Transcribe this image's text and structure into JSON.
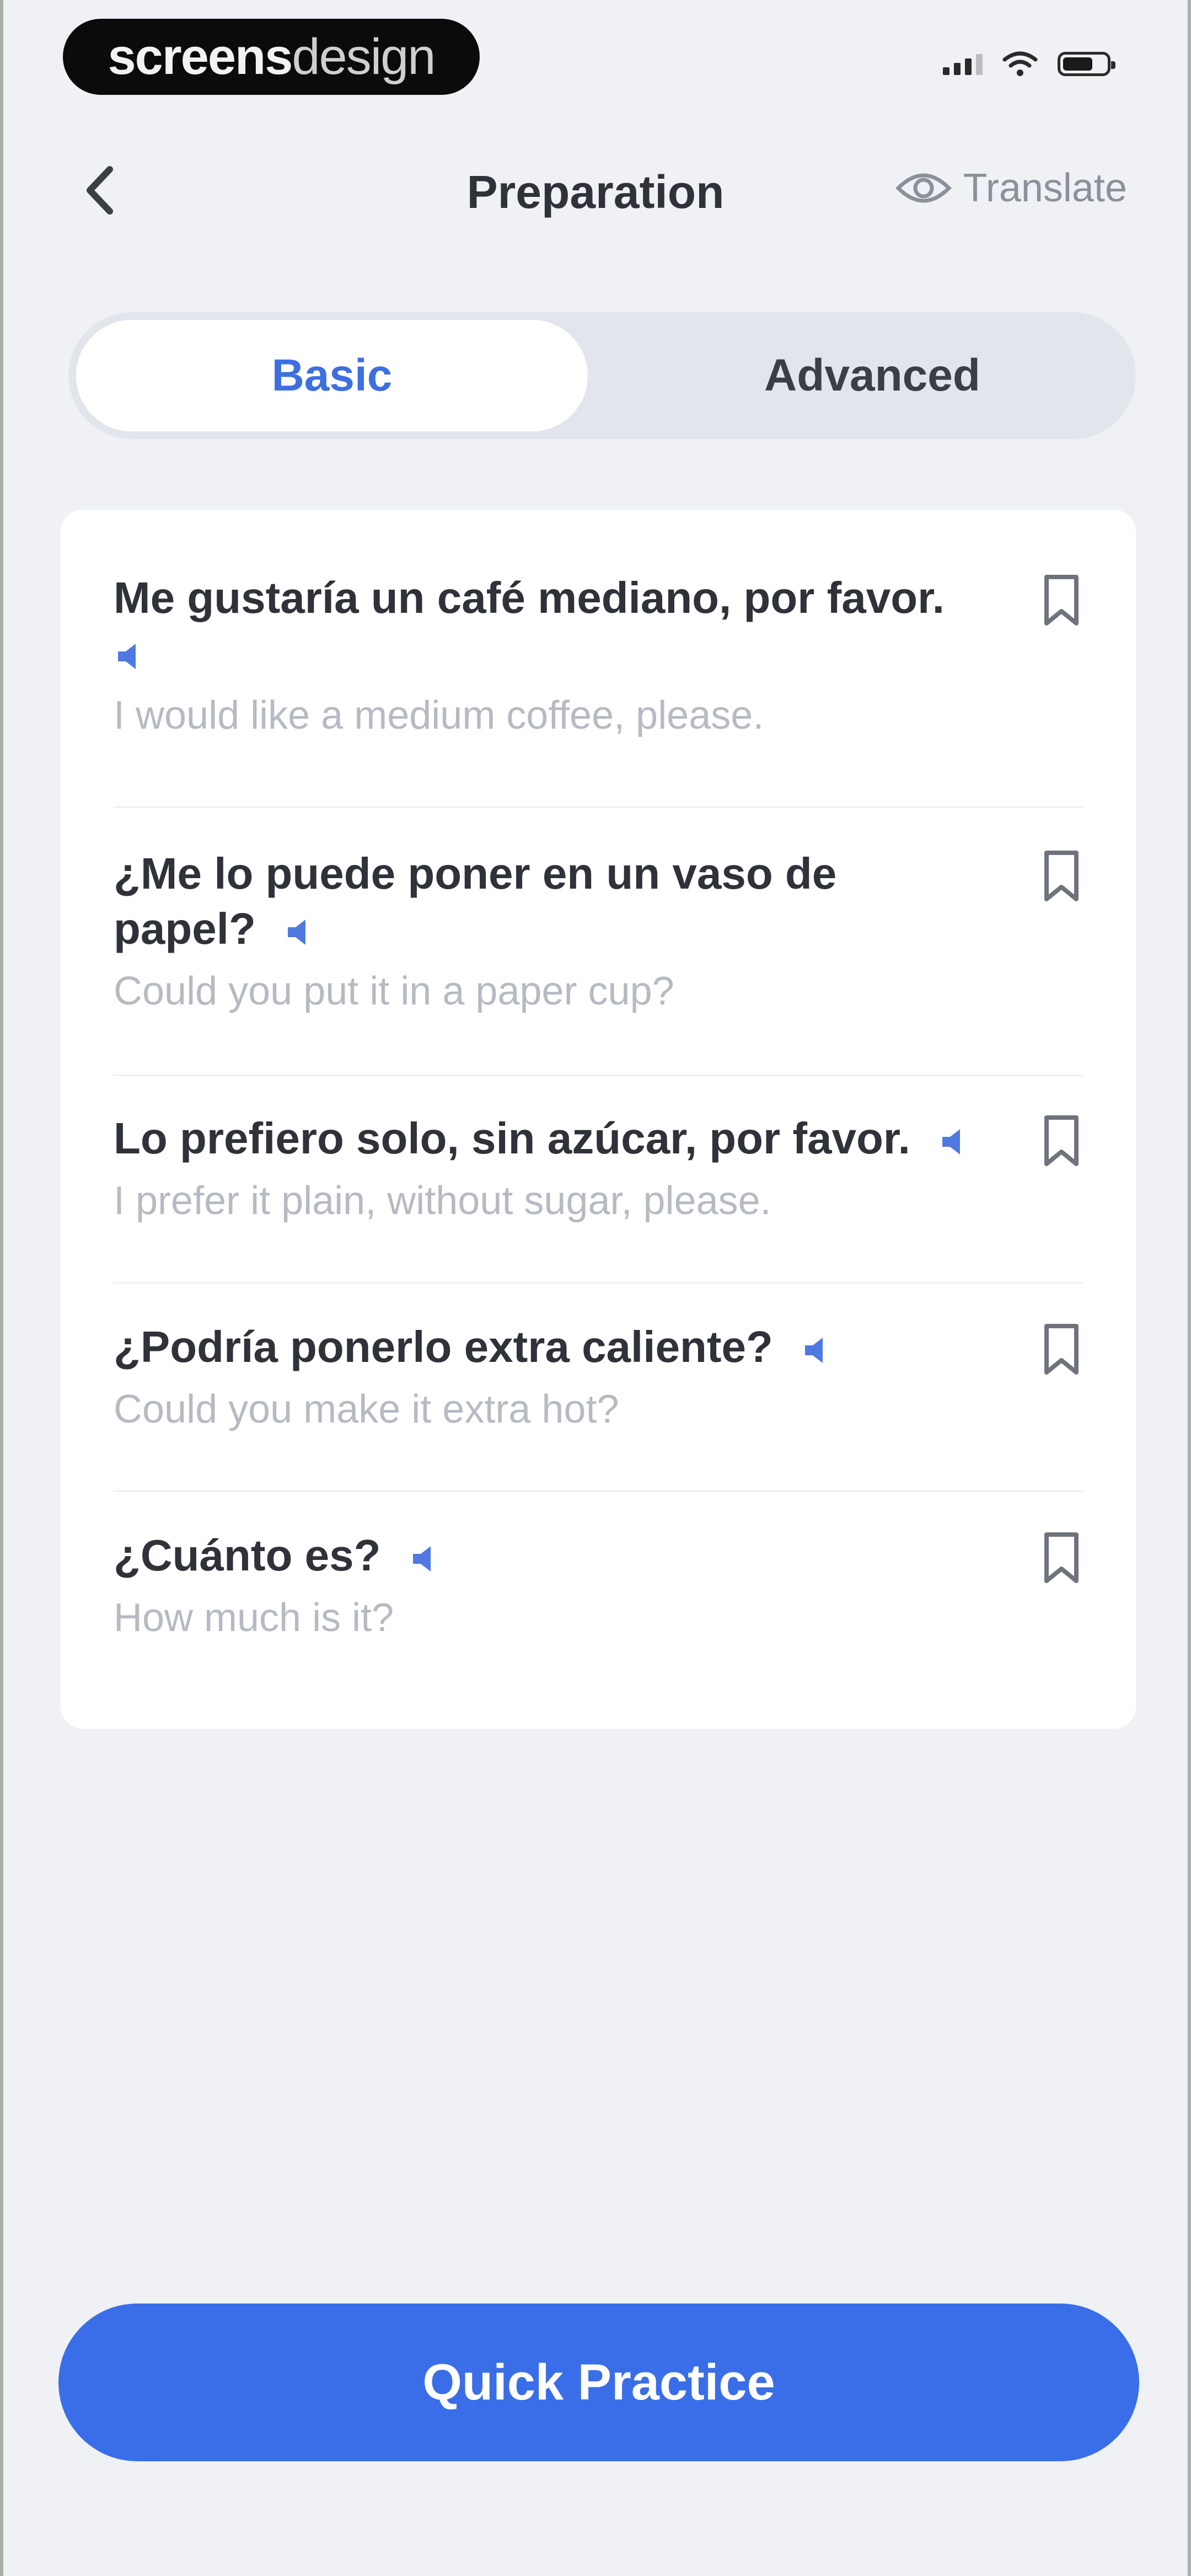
{
  "status_bar": {
    "brand_bold": "screens",
    "brand_light": "design"
  },
  "header": {
    "title": "Preparation",
    "translate_label": "Translate"
  },
  "tabs": [
    {
      "label": "Basic",
      "selected": true
    },
    {
      "label": "Advanced",
      "selected": false
    }
  ],
  "phrases": [
    {
      "spanish": "Me gustaría un café mediano, por favor.",
      "english": "I would like a medium coffee, please."
    },
    {
      "spanish": "¿Me lo puede poner en un vaso de papel?",
      "english": "Could you put it in a paper cup?"
    },
    {
      "spanish": "Lo prefiero solo, sin azúcar, por favor.",
      "english": "I prefer it plain, without sugar, please."
    },
    {
      "spanish": "¿Podría ponerlo extra caliente?",
      "english": "Could you make it extra hot?"
    },
    {
      "spanish": "¿Cuánto es?",
      "english": "How much is it?"
    }
  ],
  "footer": {
    "quick_practice_label": "Quick Practice"
  },
  "colors": {
    "accent": "#3a6ee8",
    "background": "#eff1f4",
    "card": "#ffffff",
    "muted_text": "#b6bac2"
  },
  "icons": [
    "back-chevron-icon",
    "eye-icon",
    "speaker-icon",
    "bookmark-icon",
    "signal-icon",
    "wifi-icon",
    "battery-icon"
  ]
}
